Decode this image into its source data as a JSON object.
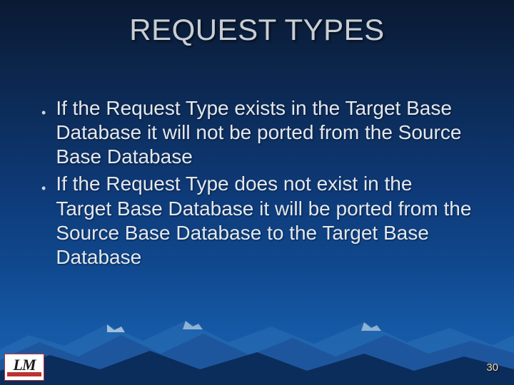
{
  "title": "REQUEST TYPES",
  "bullets": [
    "If the Request Type exists in the Target Base Database it will not be ported from the Source Base Database",
    "If the Request Type does not exist in the Target Base Database it will be ported from the Source Base Database to the Target Base Database"
  ],
  "logo_text": "LM",
  "page_number": "30"
}
